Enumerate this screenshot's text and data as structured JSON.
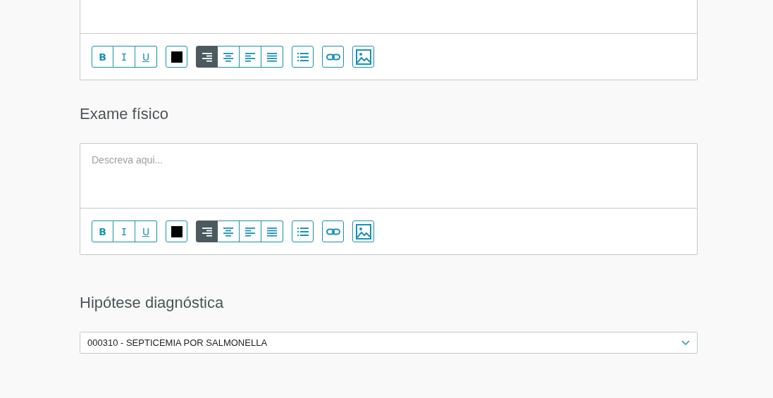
{
  "editors": [
    {
      "cut_top": true,
      "toolbar": {
        "format": [
          "B",
          "I",
          "U"
        ],
        "color": "#000000",
        "align": [
          {
            "kind": "right",
            "selected": true
          },
          {
            "kind": "center",
            "selected": false
          },
          {
            "kind": "left",
            "selected": false
          },
          {
            "kind": "justify",
            "selected": false
          }
        ]
      }
    },
    {
      "cut_top": false,
      "label": "Exame físico",
      "placeholder": "Descreva aqui...",
      "toolbar": {
        "format": [
          "B",
          "I",
          "U"
        ],
        "color": "#000000",
        "align": [
          {
            "kind": "right",
            "selected": true
          },
          {
            "kind": "center",
            "selected": false
          },
          {
            "kind": "left",
            "selected": false
          },
          {
            "kind": "justify",
            "selected": false
          }
        ]
      }
    }
  ],
  "diagnosis": {
    "label": "Hipótese diagnóstica",
    "value": "000310 - SEPTICEMIA POR SALMONELLA"
  }
}
